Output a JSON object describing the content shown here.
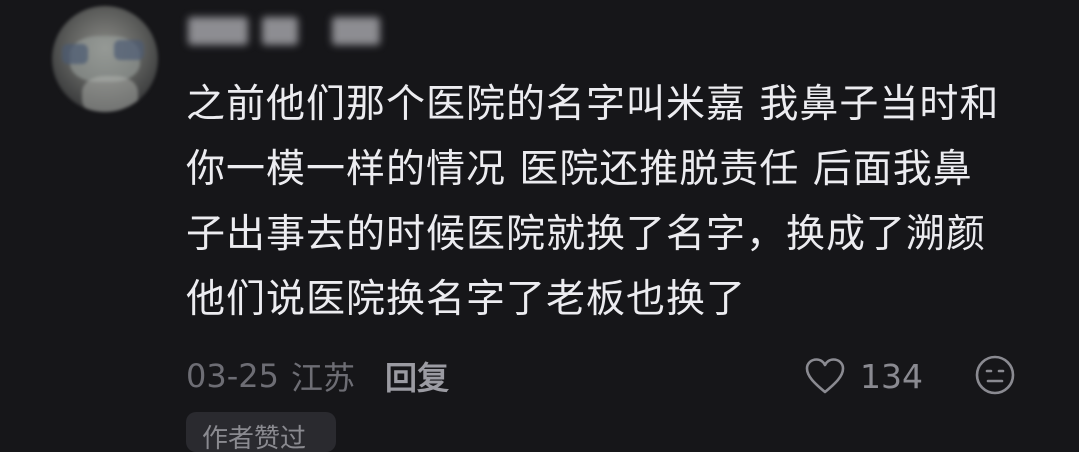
{
  "comment": {
    "username": "",
    "text_lines": [
      "之前他们那个医院的名字叫米嘉 我鼻子当时和",
      "你一模一样的情况 医院还推脱责任 后面我鼻",
      "子出事去的时候医院就换了名字，换成了溯颜",
      "他们说医院换名字了老板也换了"
    ],
    "date": "03-25",
    "location": "江苏",
    "reply_label": "回复",
    "like_count": "134",
    "author_tag": "作者赞过"
  },
  "icons": {
    "like": "heart-outline-icon",
    "dislike": "sad-face-icon"
  },
  "colors": {
    "background": "#161619",
    "text": "#ececf0",
    "meta": "#6d6d74"
  }
}
